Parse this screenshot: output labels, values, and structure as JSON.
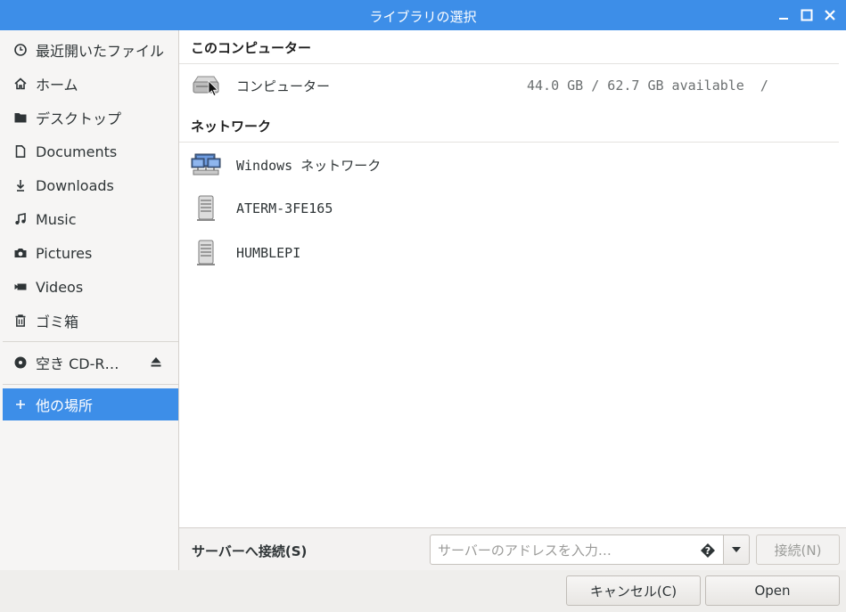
{
  "window": {
    "title": "ライブラリの選択"
  },
  "sidebar": {
    "items": [
      {
        "label": "最近開いたファイル",
        "icon": "recent-clock-icon"
      },
      {
        "label": "ホーム",
        "icon": "home-icon"
      },
      {
        "label": "デスクトップ",
        "icon": "folder-icon"
      },
      {
        "label": "Documents",
        "icon": "document-icon"
      },
      {
        "label": "Downloads",
        "icon": "download-arrow-icon"
      },
      {
        "label": "Music",
        "icon": "music-note-icon"
      },
      {
        "label": "Pictures",
        "icon": "camera-icon"
      },
      {
        "label": "Videos",
        "icon": "video-camera-icon"
      },
      {
        "label": "ゴミ箱",
        "icon": "trash-icon"
      }
    ],
    "devices": [
      {
        "label": "空き CD-R…",
        "icon": "optical-disc-icon",
        "action_icon": "eject-icon"
      }
    ],
    "other_locations": {
      "label": "他の場所",
      "icon": "plus-icon",
      "selected": true
    }
  },
  "main": {
    "this_computer": {
      "heading": "このコンピューター",
      "items": [
        {
          "name": "コンピューター",
          "info": "44.0 GB / 62.7 GB available  /",
          "icon": "hard-drive-icon"
        }
      ]
    },
    "network": {
      "heading": "ネットワーク",
      "items": [
        {
          "name": "Windows ネットワーク",
          "icon": "network-computers-icon"
        },
        {
          "name": "ATERM-3FE165",
          "icon": "server-icon"
        },
        {
          "name": "HUMBLEPI",
          "icon": "server-icon"
        }
      ]
    }
  },
  "connect": {
    "label": "サーバーへ接続(S)",
    "placeholder": "サーバーのアドレスを入力…",
    "button": "接続(N)"
  },
  "buttons": {
    "cancel": "キャンセル(C)",
    "open": "Open"
  },
  "colors": {
    "accent": "#3d8ee8",
    "sidebar_bg": "#f6f5f4"
  }
}
